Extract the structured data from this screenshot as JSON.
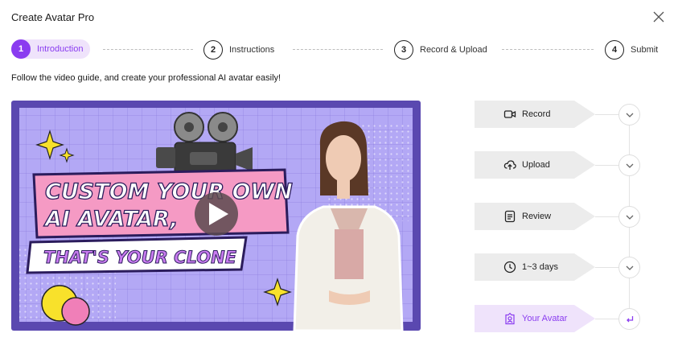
{
  "header": {
    "title": "Create Avatar Pro"
  },
  "steps": [
    {
      "number": "1",
      "label": "Introduction",
      "active": true
    },
    {
      "number": "2",
      "label": "Instructions",
      "active": false
    },
    {
      "number": "3",
      "label": "Record & Upload",
      "active": false
    },
    {
      "number": "4",
      "label": "Submit",
      "active": false
    }
  ],
  "intro": {
    "text": "Follow the video guide, and create your professional AI avatar easily!"
  },
  "video": {
    "headline_line1": "CUSTOM YOUR OWN",
    "headline_line2": "AI AVATAR,",
    "headline_line3": "THAT'S YOUR CLONE"
  },
  "workflow": [
    {
      "label": "Record",
      "icon": "video-camera-icon",
      "action_icon": "chevron-down-icon"
    },
    {
      "label": "Upload",
      "icon": "cloud-upload-icon",
      "action_icon": "chevron-down-icon"
    },
    {
      "label": "Review",
      "icon": "document-icon",
      "action_icon": "chevron-down-icon"
    },
    {
      "label": "1~3 days",
      "icon": "clock-icon",
      "action_icon": "chevron-down-icon"
    },
    {
      "label": "Your Avatar",
      "icon": "avatar-badge-icon",
      "action_icon": "return-arrow-icon"
    }
  ],
  "colors": {
    "accent": "#8a3cf0",
    "accent_light": "#efe3fb",
    "video_border": "#5a48b0",
    "banner_pink": "#f59ac4",
    "tag_gray": "#ececec"
  }
}
